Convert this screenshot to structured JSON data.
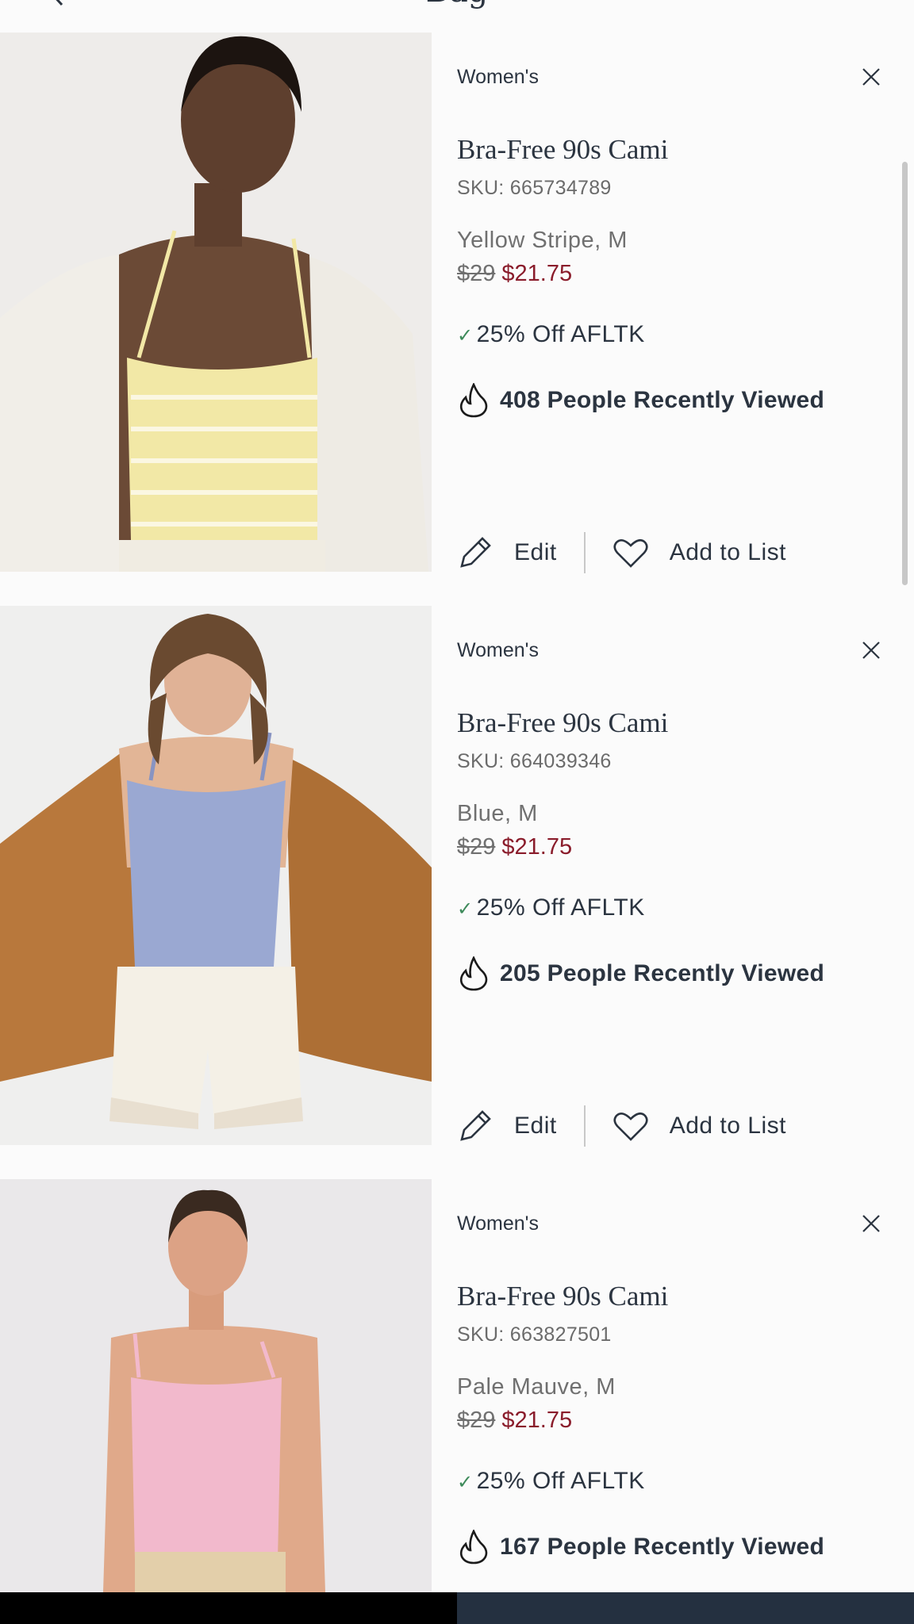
{
  "header": {
    "title": "Bag",
    "back_icon": "chevron-left-icon"
  },
  "items": [
    {
      "category": "Women's",
      "name": "Bra-Free 90s Cami",
      "sku": "SKU: 665734789",
      "variant": "Yellow Stripe, M",
      "original_price": "$29",
      "sale_price": "$21.75",
      "promo": "25% Off AFLTK",
      "viewed": "408 People Recently Viewed",
      "edit_label": "Edit",
      "list_label": "Add to List",
      "swatch": "#f2e8a6"
    },
    {
      "category": "Women's",
      "name": "Bra-Free 90s Cami",
      "sku": "SKU: 664039346",
      "variant": "Blue, M",
      "original_price": "$29",
      "sale_price": "$21.75",
      "promo": "25% Off AFLTK",
      "viewed": "205 People Recently Viewed",
      "edit_label": "Edit",
      "list_label": "Add to List",
      "swatch": "#9aa8d2"
    },
    {
      "category": "Women's",
      "name": "Bra-Free 90s Cami",
      "sku": "SKU: 663827501",
      "variant": "Pale Mauve, M",
      "original_price": "$29",
      "sale_price": "$21.75",
      "promo": "25% Off AFLTK",
      "viewed": "167 People Recently Viewed",
      "swatch": "#f2b9cc"
    }
  ],
  "colors": {
    "accent_sale": "#8a1c2b",
    "text": "#2b3440",
    "check": "#3d8a5a",
    "bottom_bar": "#243040"
  }
}
